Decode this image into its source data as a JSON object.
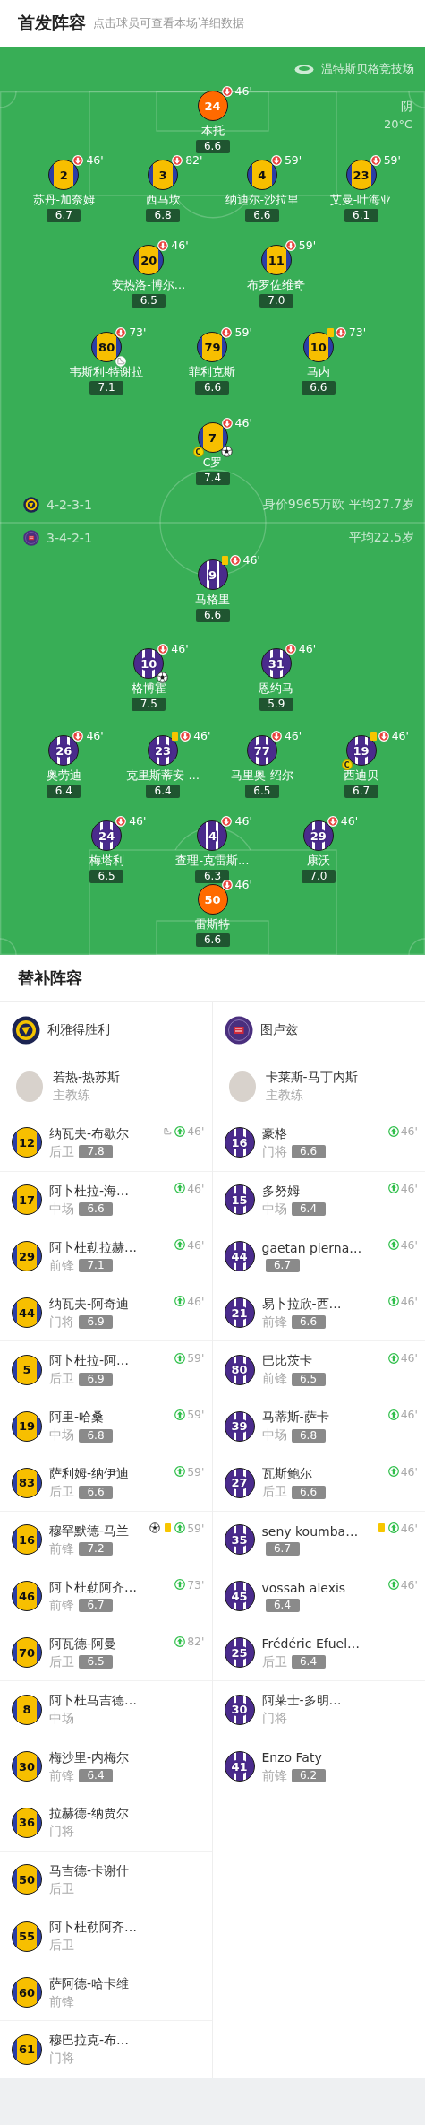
{
  "header": {
    "title": "首发阵容",
    "subtitle": "点击球员可查看本场详细数据"
  },
  "pitch": {
    "stadium": "温特斯贝格竞技场",
    "weather": "阴",
    "temperature": "20°C",
    "teams": [
      {
        "kind": "home",
        "formation": "4-2-3-1",
        "summary": "身价9965万欧 平均27.7岁",
        "rows": [
          {
            "kind": "goalkeeper",
            "players": [
              {
                "number": "24",
                "name": "本托",
                "rating": "6.6",
                "minute": "46'",
                "yellow_card": false,
                "goal": false,
                "assist": false
              }
            ]
          },
          {
            "kind": "outfield",
            "players": [
              {
                "number": "2",
                "name": "苏丹-加奈姆",
                "rating": "6.7",
                "minute": "46'",
                "yellow_card": false,
                "goal": false,
                "assist": false
              },
              {
                "number": "3",
                "name": "西马坎",
                "rating": "6.8",
                "minute": "82'",
                "yellow_card": false,
                "goal": false,
                "assist": false
              },
              {
                "number": "4",
                "name": "纳迪尔-沙拉里",
                "rating": "6.6",
                "minute": "59'",
                "yellow_card": false,
                "goal": false,
                "assist": false
              },
              {
                "number": "23",
                "name": "艾曼-叶海亚",
                "rating": "6.1",
                "minute": "59'",
                "yellow_card": false,
                "goal": false,
                "assist": false
              }
            ]
          },
          {
            "kind": "outfield",
            "players": [
              {
                "number": "20",
                "name": "安热洛-博尔…",
                "rating": "6.5",
                "minute": "46'",
                "yellow_card": false,
                "goal": false,
                "assist": false
              },
              {
                "number": "11",
                "name": "布罗佐维奇",
                "rating": "7.0",
                "minute": "59'",
                "yellow_card": false,
                "goal": false,
                "assist": false
              }
            ]
          },
          {
            "kind": "outfield",
            "players": [
              {
                "number": "80",
                "name": "韦斯利-特谢拉",
                "rating": "7.1",
                "minute": "73'",
                "yellow_card": false,
                "goal": false,
                "assist": true
              },
              {
                "number": "79",
                "name": "菲利克斯",
                "rating": "6.6",
                "minute": "59'",
                "yellow_card": false,
                "goal": false,
                "assist": false
              },
              {
                "number": "10",
                "name": "马内",
                "rating": "6.6",
                "minute": "73'",
                "yellow_card": true,
                "goal": false,
                "assist": false
              }
            ]
          },
          {
            "kind": "outfield",
            "players": [
              {
                "number": "7",
                "name": "C罗",
                "rating": "7.4",
                "minute": "46'",
                "yellow_card": false,
                "goal": true,
                "assist": false,
                "badge": "C"
              }
            ]
          }
        ]
      },
      {
        "kind": "away",
        "formation": "3-4-2-1",
        "summary": "平均22.5岁",
        "rows": [
          {
            "kind": "outfield",
            "players": [
              {
                "number": "9",
                "name": "马格里",
                "rating": "6.6",
                "minute": "46'",
                "yellow_card": true,
                "goal": false,
                "assist": false
              }
            ]
          },
          {
            "kind": "outfield",
            "players": [
              {
                "number": "10",
                "name": "格博霍",
                "rating": "7.5",
                "minute": "46'",
                "yellow_card": false,
                "goal": true,
                "assist": false
              },
              {
                "number": "31",
                "name": "恩约马",
                "rating": "5.9",
                "minute": "46'",
                "yellow_card": false,
                "goal": false,
                "assist": false
              }
            ]
          },
          {
            "kind": "outfield",
            "players": [
              {
                "number": "26",
                "name": "奥劳迪",
                "rating": "6.4",
                "minute": "46'",
                "yellow_card": false,
                "goal": false,
                "assist": false
              },
              {
                "number": "23",
                "name": "克里斯蒂安-…",
                "rating": "6.4",
                "minute": "46'",
                "yellow_card": true,
                "goal": false,
                "assist": false
              },
              {
                "number": "77",
                "name": "马里奥-绍尔",
                "rating": "6.5",
                "minute": "46'",
                "yellow_card": false,
                "goal": false,
                "assist": false
              },
              {
                "number": "19",
                "name": "西迪贝",
                "rating": "6.7",
                "minute": "46'",
                "yellow_card": true,
                "goal": false,
                "assist": false,
                "badge": "C"
              }
            ]
          },
          {
            "kind": "outfield",
            "players": [
              {
                "number": "24",
                "name": "梅塔利",
                "rating": "6.5",
                "minute": "46'",
                "yellow_card": false,
                "goal": false,
                "assist": false
              },
              {
                "number": "4",
                "name": "查理-克雷斯…",
                "rating": "6.3",
                "minute": "46'",
                "yellow_card": false,
                "goal": false,
                "assist": false
              },
              {
                "number": "29",
                "name": "康沃",
                "rating": "7.0",
                "minute": "46'",
                "yellow_card": false,
                "goal": false,
                "assist": false
              }
            ]
          },
          {
            "kind": "goalkeeper",
            "players": [
              {
                "number": "50",
                "name": "雷斯特",
                "rating": "6.6",
                "minute": "46'",
                "yellow_card": false,
                "goal": false,
                "assist": false
              }
            ]
          }
        ]
      }
    ]
  },
  "bench": {
    "title": "替补阵容",
    "teams": [
      {
        "kind": "home",
        "name": "利雅得胜利",
        "coach": {
          "name": "若热-热苏斯",
          "role": "主教练"
        },
        "players": [
          {
            "number": "12",
            "name": "纳瓦夫-布歇尔",
            "position": "后卫",
            "rating": "7.8",
            "minute": "46'",
            "yellow_card": false,
            "goal": false,
            "assist": true
          },
          {
            "number": "17",
            "name": "阿卜杜拉-海…",
            "position": "中场",
            "rating": "6.6",
            "minute": "46'",
            "yellow_card": false,
            "goal": false,
            "assist": false
          },
          {
            "number": "29",
            "name": "阿卜杜勒拉赫…",
            "position": "前锋",
            "rating": "7.1",
            "minute": "46'",
            "yellow_card": false,
            "goal": false,
            "assist": false
          },
          {
            "number": "44",
            "name": "纳瓦夫-阿奇迪",
            "position": "门将",
            "rating": "6.9",
            "minute": "46'",
            "yellow_card": false,
            "goal": false,
            "assist": false
          },
          {
            "number": "5",
            "name": "阿卜杜拉-阿…",
            "position": "后卫",
            "rating": "6.9",
            "minute": "59'",
            "yellow_card": false,
            "goal": false,
            "assist": false
          },
          {
            "number": "19",
            "name": "阿里-哈桑",
            "position": "中场",
            "rating": "6.8",
            "minute": "59'",
            "yellow_card": false,
            "goal": false,
            "assist": false
          },
          {
            "number": "83",
            "name": "萨利姆-纳伊迪",
            "position": "后卫",
            "rating": "6.6",
            "minute": "59'",
            "yellow_card": false,
            "goal": false,
            "assist": false
          },
          {
            "number": "16",
            "name": "穆罕默德-马兰",
            "position": "前锋",
            "rating": "7.2",
            "minute": "59'",
            "yellow_card": true,
            "goal": true,
            "assist": false
          },
          {
            "number": "46",
            "name": "阿卜杜勒阿齐…",
            "position": "前锋",
            "rating": "6.7",
            "minute": "73'",
            "yellow_card": false,
            "goal": false,
            "assist": false
          },
          {
            "number": "70",
            "name": "阿瓦德-阿曼",
            "position": "后卫",
            "rating": "6.5",
            "minute": "82'",
            "yellow_card": false,
            "goal": false,
            "assist": false
          },
          {
            "number": "8",
            "name": "阿卜杜马吉德…",
            "position": "中场",
            "yellow_card": false,
            "goal": false,
            "assist": false
          },
          {
            "number": "30",
            "name": "梅沙里-内梅尔",
            "position": "前锋",
            "rating": "6.4",
            "yellow_card": false,
            "goal": false,
            "assist": false
          },
          {
            "number": "36",
            "name": "拉赫德-纳贾尔",
            "position": "门将",
            "yellow_card": false,
            "goal": false,
            "assist": false
          },
          {
            "number": "50",
            "name": "马吉德-卡谢什",
            "position": "后卫",
            "yellow_card": false,
            "goal": false,
            "assist": false
          },
          {
            "number": "55",
            "name": "阿卜杜勒阿齐…",
            "position": "后卫",
            "yellow_card": false,
            "goal": false,
            "assist": false
          },
          {
            "number": "60",
            "name": "萨阿德-哈卡维",
            "position": "前锋",
            "yellow_card": false,
            "goal": false,
            "assist": false
          },
          {
            "number": "61",
            "name": "穆巴拉克-布…",
            "position": "门将",
            "yellow_card": false,
            "goal": false,
            "assist": false
          }
        ]
      },
      {
        "kind": "away",
        "name": "图卢兹",
        "coach": {
          "name": "卡莱斯-马丁内斯",
          "role": "主教练"
        },
        "players": [
          {
            "number": "16",
            "name": "豪格",
            "position": "门将",
            "rating": "6.6",
            "minute": "46'",
            "yellow_card": false,
            "goal": false,
            "assist": false
          },
          {
            "number": "15",
            "name": "多努姆",
            "position": "中场",
            "rating": "6.4",
            "minute": "46'",
            "yellow_card": false,
            "goal": false,
            "assist": false
          },
          {
            "number": "44",
            "name": "gaetan pierna…",
            "rating": "6.7",
            "minute": "46'",
            "yellow_card": false,
            "goal": false,
            "assist": false
          },
          {
            "number": "21",
            "name": "易卜拉欣-西…",
            "position": "前锋",
            "rating": "6.6",
            "minute": "46'",
            "yellow_card": false,
            "goal": false,
            "assist": false
          },
          {
            "number": "80",
            "name": "巴比茨卡",
            "position": "前锋",
            "rating": "6.5",
            "minute": "46'",
            "yellow_card": false,
            "goal": false,
            "assist": false
          },
          {
            "number": "39",
            "name": "马蒂斯-萨卡",
            "position": "中场",
            "rating": "6.8",
            "minute": "46'",
            "yellow_card": false,
            "goal": false,
            "assist": false
          },
          {
            "number": "27",
            "name": "瓦斯鲍尔",
            "position": "后卫",
            "rating": "6.6",
            "minute": "46'",
            "yellow_card": false,
            "goal": false,
            "assist": false
          },
          {
            "number": "35",
            "name": "seny koumba…",
            "rating": "6.7",
            "minute": "46'",
            "yellow_card": true,
            "goal": false,
            "assist": false
          },
          {
            "number": "45",
            "name": "vossah alexis",
            "rating": "6.4",
            "minute": "46'",
            "yellow_card": false,
            "goal": false,
            "assist": false
          },
          {
            "number": "25",
            "name": "Frédéric Efuel…",
            "position": "后卫",
            "rating": "6.4",
            "yellow_card": false,
            "goal": false,
            "assist": false
          },
          {
            "number": "30",
            "name": "阿莱士-多明…",
            "position": "门将",
            "yellow_card": false,
            "goal": false,
            "assist": false
          },
          {
            "number": "41",
            "name": "Enzo Faty",
            "position": "前锋",
            "rating": "6.2",
            "yellow_card": false,
            "goal": false,
            "assist": false
          }
        ]
      }
    ]
  }
}
